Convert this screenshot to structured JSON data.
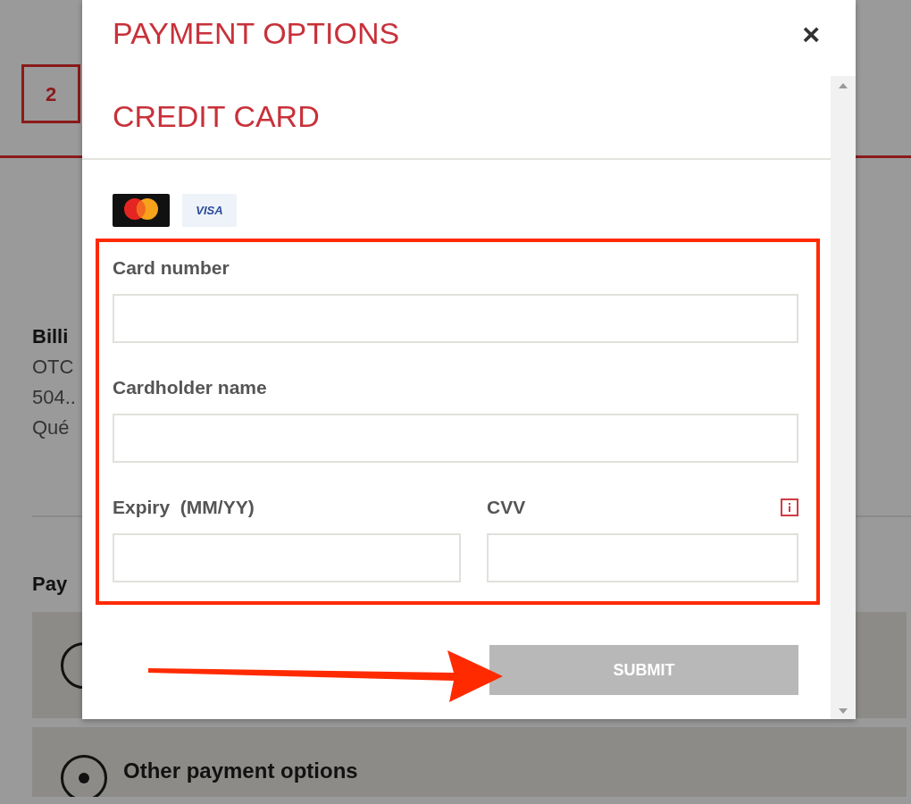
{
  "background": {
    "step": "2",
    "billing": {
      "title": "Billi",
      "lines": [
        "OTC",
        "504..",
        "Qué"
      ]
    },
    "payment_title": "Pay",
    "options": [
      {
        "selected": false
      },
      {
        "label": "Other payment options",
        "selected": true
      }
    ]
  },
  "modal": {
    "title": "PAYMENT OPTIONS",
    "close": "×",
    "section_title": "CREDIT CARD",
    "card_brands": [
      {
        "kind": "mastercard"
      },
      {
        "kind": "visa",
        "text": "VISA"
      }
    ],
    "form_highlighted": true,
    "rows": [
      {
        "fields": [
          {
            "label": "Card number",
            "info_icon": false
          }
        ]
      },
      {
        "fields": [
          {
            "label": "Cardholder name",
            "info_icon": false
          }
        ]
      },
      {
        "fields": [
          {
            "label": "Expiry  (MM/YY)",
            "info_icon": false
          },
          {
            "label": "CVV",
            "info_icon": true
          }
        ]
      }
    ],
    "submit": {
      "label": "SUBMIT",
      "disabled": true
    },
    "arrow_to_submit": true
  }
}
